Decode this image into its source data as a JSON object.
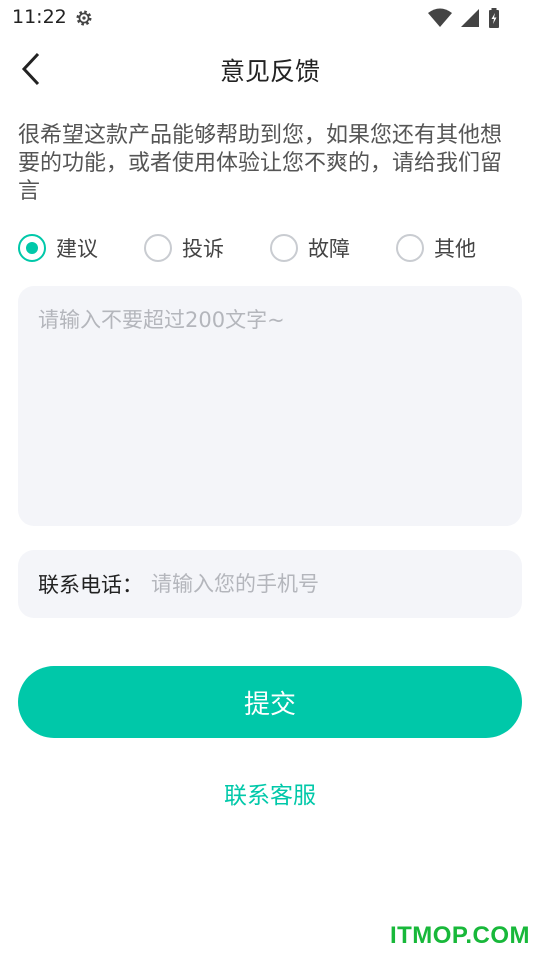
{
  "status_bar": {
    "time": "11:22"
  },
  "nav": {
    "title": "意见反馈"
  },
  "intro": "很希望这款产品能够帮助到您，如果您还有其他想要的功能，或者使用体验让您不爽的，请给我们留言",
  "feedback_types": [
    {
      "label": "建议",
      "selected": true
    },
    {
      "label": "投诉",
      "selected": false
    },
    {
      "label": "故障",
      "selected": false
    },
    {
      "label": "其他",
      "selected": false
    }
  ],
  "content": {
    "value": "",
    "placeholder": "请输入不要超过200文字~"
  },
  "phone": {
    "label": "联系电话：",
    "value": "",
    "placeholder": "请输入您的手机号"
  },
  "submit_label": "提交",
  "contact_label": "联系客服",
  "watermark": "ITMOP.COM",
  "colors": {
    "accent": "#00c8a9",
    "field_bg": "#f4f5f9",
    "watermark": "#18b83a"
  }
}
